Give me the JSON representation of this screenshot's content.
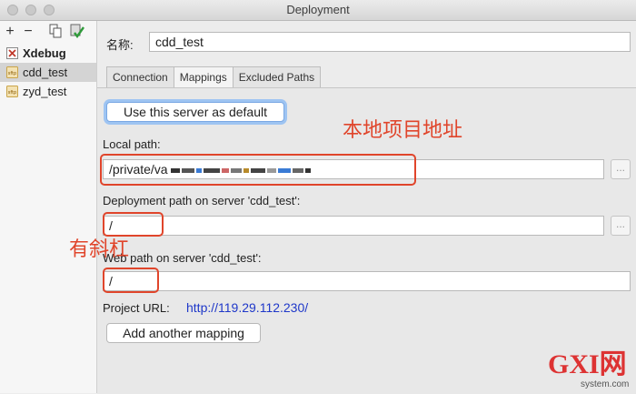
{
  "window": {
    "title": "Deployment"
  },
  "toolbar": {
    "add": "+",
    "remove": "−"
  },
  "servers": [
    {
      "label": "Xdebug",
      "bold": true
    },
    {
      "label": "cdd_test",
      "selected": true
    },
    {
      "label": "zyd_test"
    }
  ],
  "name_label": "名称:",
  "name_value": "cdd_test",
  "tabs": [
    "Connection",
    "Mappings",
    "Excluded Paths"
  ],
  "default_button": "Use this server as default",
  "local_path": {
    "label": "Local path:",
    "value": "/private/va"
  },
  "deployment_path": {
    "label": "Deployment path on server 'cdd_test':",
    "value": "/"
  },
  "web_path": {
    "label": "Web path on server 'cdd_test':",
    "value": "/"
  },
  "project_url": {
    "label": "Project URL:",
    "value": "http://119.29.112.230/"
  },
  "add_mapping": "Add another mapping",
  "browse": "...",
  "annotations": {
    "local_addr": "本地项目地址",
    "slash": "有斜杠"
  },
  "watermark": {
    "brand": "GXI网",
    "site": "system.com"
  },
  "colors": {
    "annotation": "#e0452b",
    "link": "#1f38c9",
    "focus": "#9ec4f2"
  }
}
